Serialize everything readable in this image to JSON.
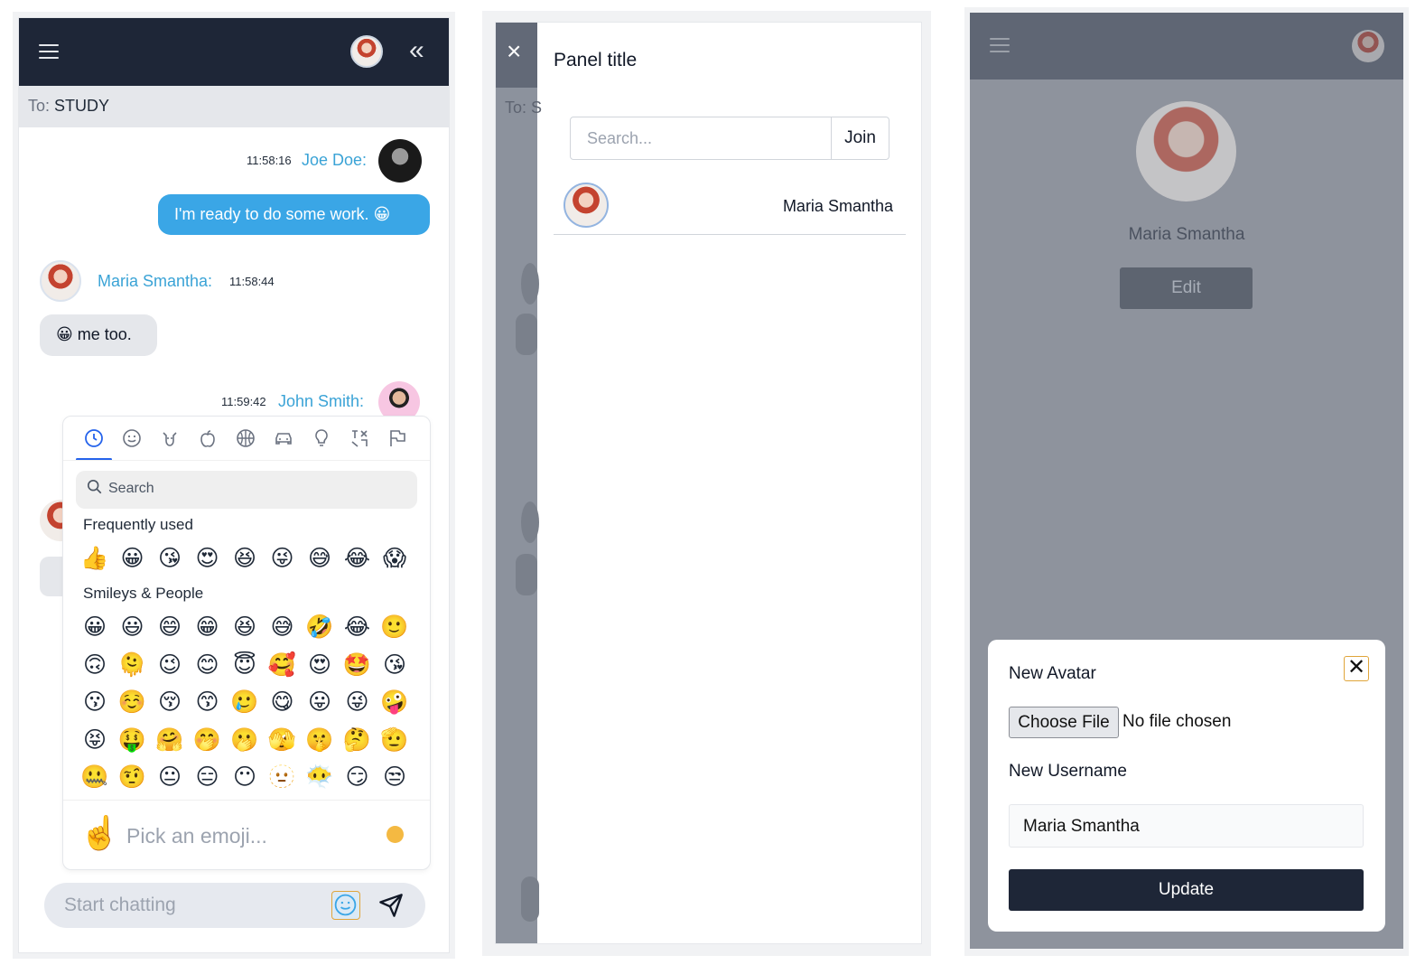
{
  "chat": {
    "to_label": "To:",
    "to_value": "STUDY",
    "messages": [
      {
        "time": "11:58:16",
        "name": "Joe Doe:",
        "text": "I'm ready to do some work. 😀"
      },
      {
        "time": "11:58:44",
        "name": "Maria Smantha:",
        "text": "😀 me too."
      },
      {
        "time": "11:59:42",
        "name": "John Smith:"
      }
    ],
    "composer_placeholder": "Start chatting"
  },
  "emoji_picker": {
    "categories": [
      "recent",
      "smileys",
      "animals",
      "food",
      "activity",
      "travel",
      "objects",
      "symbols",
      "flags"
    ],
    "search_placeholder": "Search",
    "frequent_title": "Frequently used",
    "frequent": [
      "👍",
      "😀",
      "😘",
      "😍",
      "😆",
      "😜",
      "😅",
      "😂",
      "😱"
    ],
    "smileys_title": "Smileys & People",
    "smileys": [
      [
        "😀",
        "😃",
        "😄",
        "😁",
        "😆",
        "😅",
        "🤣",
        "😂",
        "🙂"
      ],
      [
        "🙃",
        "🫠",
        "😉",
        "😊",
        "😇",
        "🥰",
        "😍",
        "🤩",
        "😘"
      ],
      [
        "😗",
        "☺️",
        "😚",
        "😙",
        "🥲",
        "😋",
        "😛",
        "😜",
        "🤪"
      ],
      [
        "😝",
        "🤑",
        "🤗",
        "🤭",
        "🫢",
        "🫣",
        "🤫",
        "🤔",
        "🫡"
      ],
      [
        "🤐",
        "🤨",
        "😐",
        "😑",
        "😶",
        "🫥",
        "😶‍🌫️",
        "😏",
        "😒"
      ]
    ],
    "preview_emoji": "☝️",
    "preview_text": "Pick an emoji..."
  },
  "panel": {
    "close_label": "×",
    "dim_to": "To: S",
    "title": "Panel title",
    "search_placeholder": "Search...",
    "join_label": "Join",
    "users": [
      {
        "name": "Maria Smantha"
      }
    ]
  },
  "profile": {
    "name": "Maria Smantha",
    "edit_label": "Edit",
    "modal": {
      "title": "New Avatar",
      "file_button": "Choose File",
      "file_status": "No file chosen",
      "username_label": "New Username",
      "username_value": "Maria Smantha",
      "update_label": "Update",
      "close_label": "✕"
    }
  },
  "colors": {
    "header": "#1e2637",
    "accent_blue": "#3aa6e6",
    "name_blue": "#3aa3d6",
    "overlay": "#8e939d"
  }
}
